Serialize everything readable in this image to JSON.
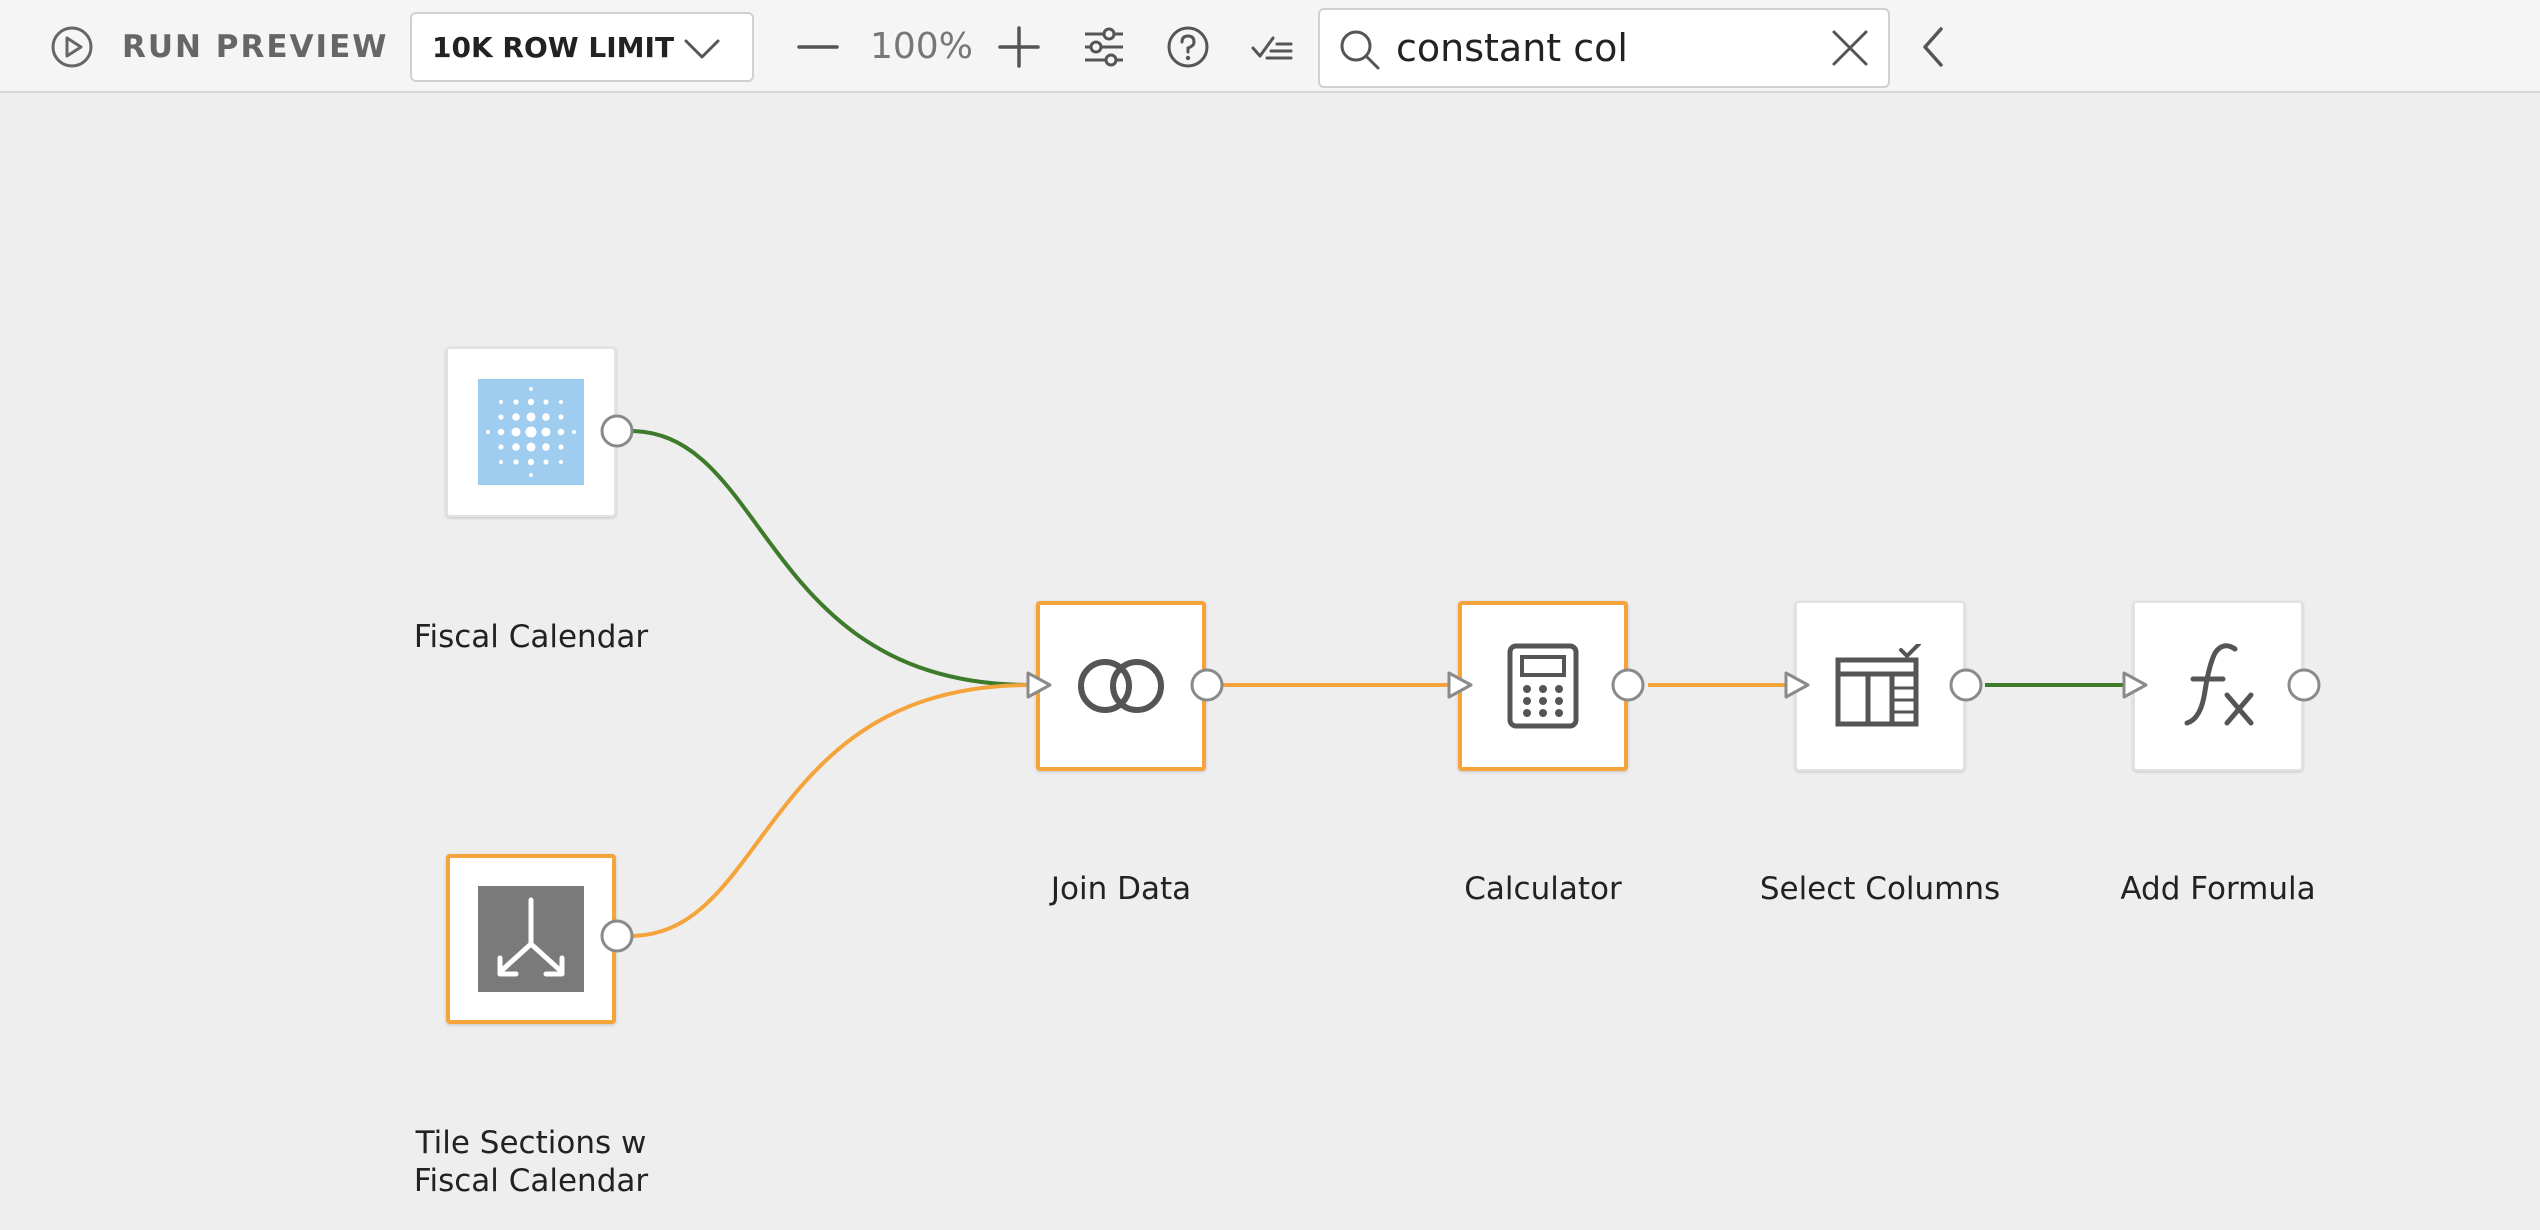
{
  "toolbar": {
    "run_preview_label": "RUN PREVIEW",
    "row_limit_value": "10K ROW LIMIT",
    "zoom_value": "100%",
    "search_value": "constant col"
  },
  "nodes": {
    "fiscal_calendar": {
      "label": "Fiscal Calendar"
    },
    "tile_sections": {
      "label_line1": "Tile Sections w",
      "label_line2": "Fiscal Calendar"
    },
    "join_data": {
      "label": "Join Data"
    },
    "calculator": {
      "label": "Calculator"
    },
    "select_columns": {
      "label": "Select Columns"
    },
    "add_formula": {
      "label": "Add Formula"
    }
  },
  "colors": {
    "selected_border": "#f5a33b",
    "wire_green": "#3d7a2a",
    "wire_orange": "#f5a33b",
    "dataset_blue": "#9ecdf0",
    "tile_gray": "#7a7a7a",
    "icon_gray": "#555555"
  }
}
